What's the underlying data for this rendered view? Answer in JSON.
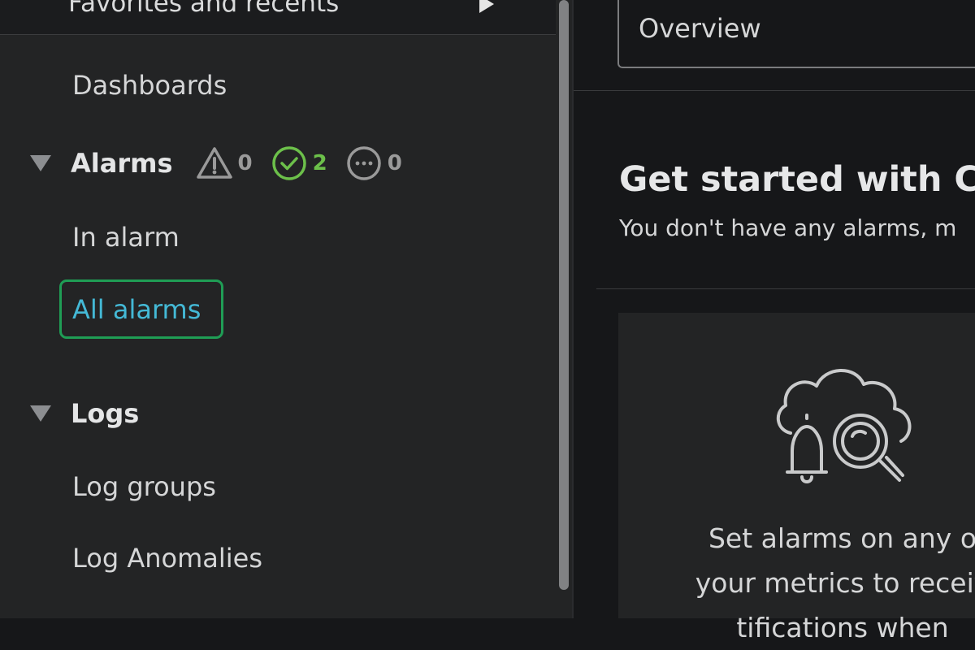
{
  "sidebar": {
    "favorites_label": "Favorites and recents",
    "dashboards_label": "Dashboards",
    "alarms": {
      "title": "Alarms",
      "in_alarm_count": "0",
      "ok_count": "2",
      "insufficient_count": "0",
      "items": [
        "In alarm",
        "All alarms"
      ]
    },
    "logs": {
      "title": "Logs",
      "items": [
        "Log groups",
        "Log Anomalies"
      ]
    }
  },
  "main": {
    "select_value": "Overview",
    "panel_title": "Get started with Clo",
    "panel_subtitle": "You don't have any alarms, m",
    "card_lines": [
      "Set alarms on any o",
      "your metrics to receiv",
      "tifications when"
    ]
  },
  "colors": {
    "active_link": "#44b9d6",
    "active_outline": "#1f9d55",
    "ok_status": "#6cc04a"
  }
}
